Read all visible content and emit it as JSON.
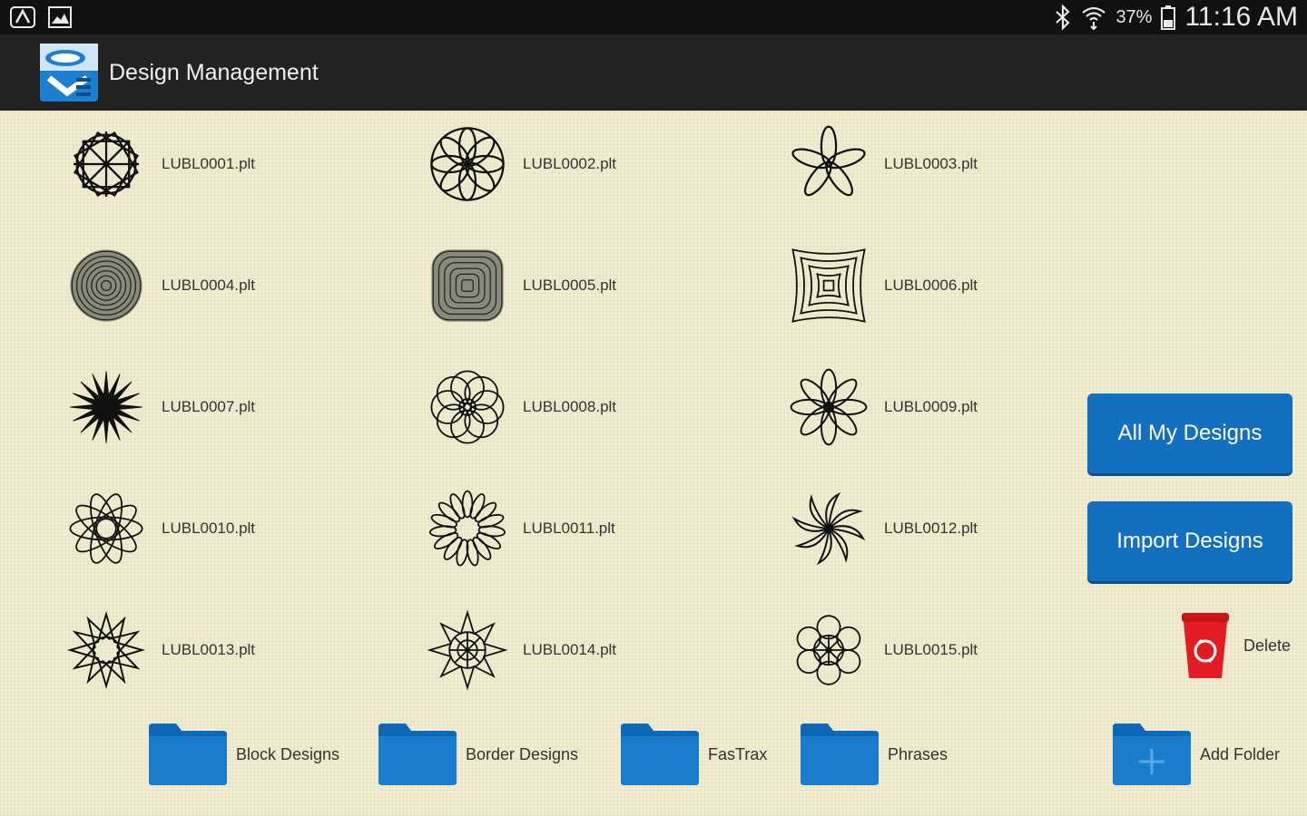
{
  "status_bar": {
    "battery_percent": "37%",
    "time": "11:16 AM",
    "icons": [
      "notification-icon",
      "image-icon",
      "bluetooth-icon",
      "wifi-icon",
      "battery-icon"
    ]
  },
  "app_bar": {
    "title": "Design Management",
    "logo_icon": "app-logo-icon"
  },
  "designs": [
    {
      "name": "LUBL0001.plt",
      "icon": "star-rosette-icon"
    },
    {
      "name": "LUBL0002.plt",
      "icon": "petal-flower-icon"
    },
    {
      "name": "LUBL0003.plt",
      "icon": "five-petal-flower-icon"
    },
    {
      "name": "LUBL0004.plt",
      "icon": "concentric-circle-icon"
    },
    {
      "name": "LUBL0005.plt",
      "icon": "concentric-square-icon"
    },
    {
      "name": "LUBL0006.plt",
      "icon": "nested-square-icon"
    },
    {
      "name": "LUBL0007.plt",
      "icon": "starburst-icon"
    },
    {
      "name": "LUBL0008.plt",
      "icon": "knot-rosette-icon"
    },
    {
      "name": "LUBL0009.plt",
      "icon": "daisy-icon"
    },
    {
      "name": "LUBL0010.plt",
      "icon": "star-weave-icon"
    },
    {
      "name": "LUBL0011.plt",
      "icon": "scalloped-flower-icon"
    },
    {
      "name": "LUBL0012.plt",
      "icon": "swirl-icon"
    },
    {
      "name": "LUBL0013.plt",
      "icon": "pinwheel-star-icon"
    },
    {
      "name": "LUBL0014.plt",
      "icon": "spiky-star-icon"
    },
    {
      "name": "LUBL0015.plt",
      "icon": "lace-rosette-icon"
    }
  ],
  "actions": {
    "all_my_designs": "All My Designs",
    "import_designs": "Import Designs",
    "delete": "Delete"
  },
  "folders": [
    {
      "name": "Block Designs"
    },
    {
      "name": "Border Designs"
    },
    {
      "name": "FasTrax"
    },
    {
      "name": "Phrases"
    }
  ],
  "add_folder": "Add Folder",
  "colors": {
    "background": "#f1ecd0",
    "accent_blue": "#1370c1",
    "delete_red": "#e31b23",
    "status_bar": "#111111",
    "app_bar": "#222222"
  }
}
